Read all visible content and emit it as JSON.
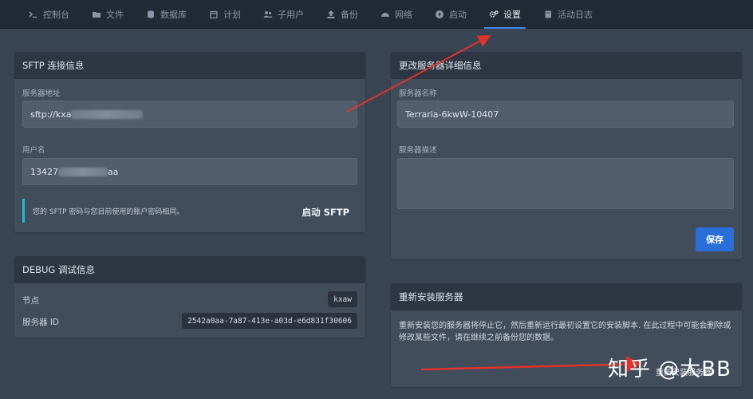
{
  "nav": {
    "tabs": [
      {
        "label": "控制台",
        "icon": "terminal-icon"
      },
      {
        "label": "文件",
        "icon": "folder-icon"
      },
      {
        "label": "数据库",
        "icon": "database-icon"
      },
      {
        "label": "计划",
        "icon": "calendar-icon"
      },
      {
        "label": "子用户",
        "icon": "users-icon"
      },
      {
        "label": "备份",
        "icon": "upload-icon"
      },
      {
        "label": "网络",
        "icon": "network-icon"
      },
      {
        "label": "启动",
        "icon": "play-icon"
      },
      {
        "label": "设置",
        "icon": "gears-icon"
      },
      {
        "label": "活动日志",
        "icon": "book-icon"
      }
    ],
    "active_tab": "设置"
  },
  "sftp": {
    "title": "SFTP 连接信息",
    "address_label": "服务器地址",
    "address_value": "sftp://kxa",
    "username_label": "用户名",
    "username_prefix": "13427",
    "username_suffix": "aa",
    "note": "您的 SFTP 密码与您目前使用的账户密码相同。",
    "launch_button": "启动 SFTP"
  },
  "debug": {
    "title": "DEBUG 调试信息",
    "node_label": "节点",
    "node_value": "kxaw",
    "server_id_label": "服务器 ID",
    "server_id_value": "2542a0aa-7a87-413e-a03d-e6d831f30606"
  },
  "details": {
    "title": "更改服务器详细信息",
    "name_label": "服务器名称",
    "name_value": "Terraria-6kwW-10407",
    "desc_label": "服务器描述",
    "desc_value": "",
    "save_button": "保存"
  },
  "reinstall": {
    "title": "重新安装服务器",
    "description": "重新安装您的服务器将停止它，然后重新运行最初设置它的安装脚本. 在此过程中可能会删除或修改某些文件，请在继续之前备份您的数据。",
    "button_partial": "重新安装服务器"
  },
  "watermark": {
    "text": "知乎 @大BB"
  },
  "colors": {
    "accent": "#3f86e6",
    "annotation_arrow": "#e0332a",
    "note_border": "#2ab6c8"
  }
}
